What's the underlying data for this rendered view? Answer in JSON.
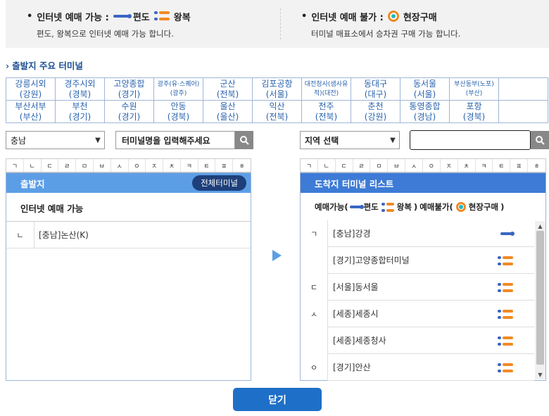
{
  "info": {
    "left_title": "인터넷 예매 가능 :",
    "oneway_label": "편도",
    "roundtrip_label": "왕복",
    "left_desc": "편도, 왕복으로 인터넷 예매 가능 합니다.",
    "right_title": "인터넷 예매 불가 :",
    "onsite_label": "현장구매",
    "right_desc": "터미널 매표소에서 승차권 구매 가능 합니다."
  },
  "section_title": "출발지 주요 터미널",
  "major_terminals": [
    {
      "name": "강릉시외",
      "region": "(강원)"
    },
    {
      "name": "경주시외",
      "region": "(경북)"
    },
    {
      "name": "고양종합",
      "region": "(경기)"
    },
    {
      "name": "광주(유·스퀘어)",
      "region": "(광주)",
      "small": true
    },
    {
      "name": "군산",
      "region": "(전북)"
    },
    {
      "name": "김포공항",
      "region": "(서울)"
    },
    {
      "name": "대전청사(샘사유",
      "region": "적)(대전)",
      "small": true
    },
    {
      "name": "동대구",
      "region": "(대구)"
    },
    {
      "name": "동서울",
      "region": "(서울)"
    },
    {
      "name": "부산동부(노포)",
      "region": "(부산)",
      "small": true
    },
    {
      "name": "",
      "region": ""
    },
    {
      "name": "부산서부",
      "region": "(부산)"
    },
    {
      "name": "부천",
      "region": "(경기)"
    },
    {
      "name": "수원",
      "region": "(경기)"
    },
    {
      "name": "안동",
      "region": "(경북)"
    },
    {
      "name": "울산",
      "region": "(울산)"
    },
    {
      "name": "익산",
      "region": "(전북)"
    },
    {
      "name": "전주",
      "region": "(전북)"
    },
    {
      "name": "춘천",
      "region": "(강원)"
    },
    {
      "name": "통영종합",
      "region": "(경남)"
    },
    {
      "name": "포항",
      "region": "(경북)"
    },
    {
      "name": "",
      "region": ""
    }
  ],
  "departure": {
    "region_select": "충남",
    "search_placeholder": "터미널명을 입력해주세요",
    "header": "출발지",
    "all_button": "전체터미널",
    "sub_header": "인터넷 예매 가능",
    "rows": [
      {
        "key": "ㄴ",
        "text": "[충남]논산(K)"
      }
    ]
  },
  "consonants": [
    "ㄱ",
    "ㄴ",
    "ㄷ",
    "ㄹ",
    "ㅁ",
    "ㅂ",
    "ㅅ",
    "ㅇ",
    "ㅈ",
    "ㅊ",
    "ㅋ",
    "ㅌ",
    "ㅍ",
    "ㅎ"
  ],
  "arrival": {
    "region_select": "지역 선택",
    "search_value": "",
    "header": "도착지 터미널 리스트",
    "legend": {
      "bookable": "예매가능(",
      "oneway": "편도",
      "roundtrip": "왕복",
      "close_bookable": ")",
      "not_bookable": "예매불가(",
      "onsite": "현장구매",
      "close_not": ")"
    },
    "rows": [
      {
        "key": "ㄱ",
        "text": "[충남]강경",
        "icon": "oneway-icon"
      },
      {
        "key": "",
        "text": "[경기]고양종합터미널",
        "icon": "roundtrip-icon"
      },
      {
        "key": "ㄷ",
        "text": "[서울]동서울",
        "icon": "roundtrip-icon"
      },
      {
        "key": "ㅅ",
        "text": "[세종]세종시",
        "icon": "roundtrip-icon"
      },
      {
        "key": "",
        "text": "[세종]세종청사",
        "icon": "roundtrip-icon"
      },
      {
        "key": "ㅇ",
        "text": "[경기]안산",
        "icon": "roundtrip-icon"
      }
    ]
  },
  "close_button": "닫기",
  "colors": {
    "accent": "#1e6fc7",
    "oneway": "#3a66c4",
    "roundtrip": "#f08a24",
    "onsite_dot": "#1fb8c0"
  }
}
